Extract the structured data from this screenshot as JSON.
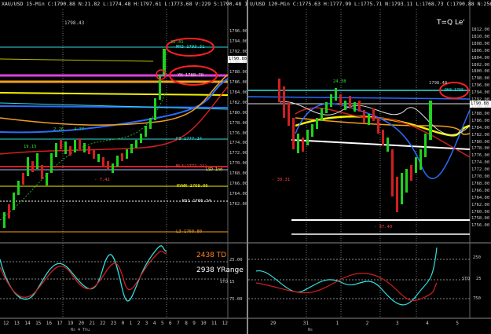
{
  "left": {
    "header": "XAU/USD  15-Min  C:1790.88  N:21.82  L:1774.48  H:1797.61  L:1773.68  V:229  S:1790.48  11-03-21  9:59",
    "price_top": "1798.43",
    "y_ticks": [
      "1796.00",
      "1794.00",
      "1792.00",
      "1790.00",
      "1788.00",
      "1786.00",
      "1784.00",
      "1782.00",
      "1780.00",
      "1778.00",
      "1776.00",
      "1774.00",
      "1772.00",
      "1770.00",
      "1768.00",
      "1766.00",
      "1764.00",
      "1762.00"
    ],
    "current_price": "1790.88",
    "labels": {
      "top_num": "22.41",
      "mh3": "MH3 1793.31",
      "yh": "YH 1788.70",
      "h3": "H3 1777.14",
      "l3_mid": "ML3(1772.21)",
      "rvwr": "RVWR 1769.06",
      "rs1": "RS1 1766.34",
      "l3": "L3 1760.80",
      "n26": "2.26",
      "n477": "4.77",
      "n1915": "19.15",
      "n742": "- 7.42",
      "last": "LSD 1nd",
      "neg2": "-2.91"
    },
    "osc": {
      "td": "2438 TD",
      "yrange": "2938 YRange",
      "sto": "STO",
      "ticks": [
        "25.00",
        "15",
        "75.00"
      ]
    },
    "x_ticks": [
      "12",
      "13",
      "14",
      "15",
      "16",
      "17",
      "19",
      "20",
      "21",
      "22",
      "23",
      "0",
      "1",
      "2",
      "3",
      "4",
      "5",
      "6",
      "7",
      "8",
      "9",
      "10",
      "11",
      "12"
    ],
    "x_sub": "Ns 4 Thu"
  },
  "right": {
    "header": "U/USD  120-Min  C:1775.63  H:1777.99  L:1775.71  N:1793.11  L:1768.73  C:1790.88  N:2562  S:1798.48  11-03-21  1:39.59",
    "title": "T=Q Le'",
    "price_top": "1798.48",
    "y_ticks": [
      "1812.00",
      "1810.00",
      "1808.00",
      "1806.00",
      "1804.00",
      "1802.00",
      "1800.00",
      "1798.00",
      "1796.00",
      "1794.00",
      "1792.00",
      "1790.00",
      "1788.00",
      "1786.00",
      "1784.00",
      "1782.00",
      "1780.00",
      "1778.00",
      "1776.00",
      "1774.00",
      "1772.00",
      "1770.00",
      "1768.00",
      "1766.00",
      "1764.00",
      "1762.00",
      "1760.00",
      "1758.00",
      "1756.00"
    ],
    "current_price": "1790.88",
    "labels": {
      "n2438": "24.38",
      "n3931": "- 39.31",
      "n3740": "- 37.40",
      "circle": "DH3 1795"
    },
    "osc": {
      "sto": "STO",
      "ticks": [
        "250",
        "25",
        "750"
      ]
    },
    "x_ticks": [
      "29",
      "31",
      "1",
      "2",
      "3",
      "4",
      "5"
    ],
    "x_sub": "Ns"
  },
  "colors": {
    "bg": "#000000",
    "up": "#1fd21f",
    "down": "#d21f1f",
    "cyan": "#33dddd",
    "yellow": "#f4f400",
    "orange": "#f0a020",
    "blue": "#2b6cff",
    "magenta": "#e040e0",
    "annot": "#ff2020"
  }
}
